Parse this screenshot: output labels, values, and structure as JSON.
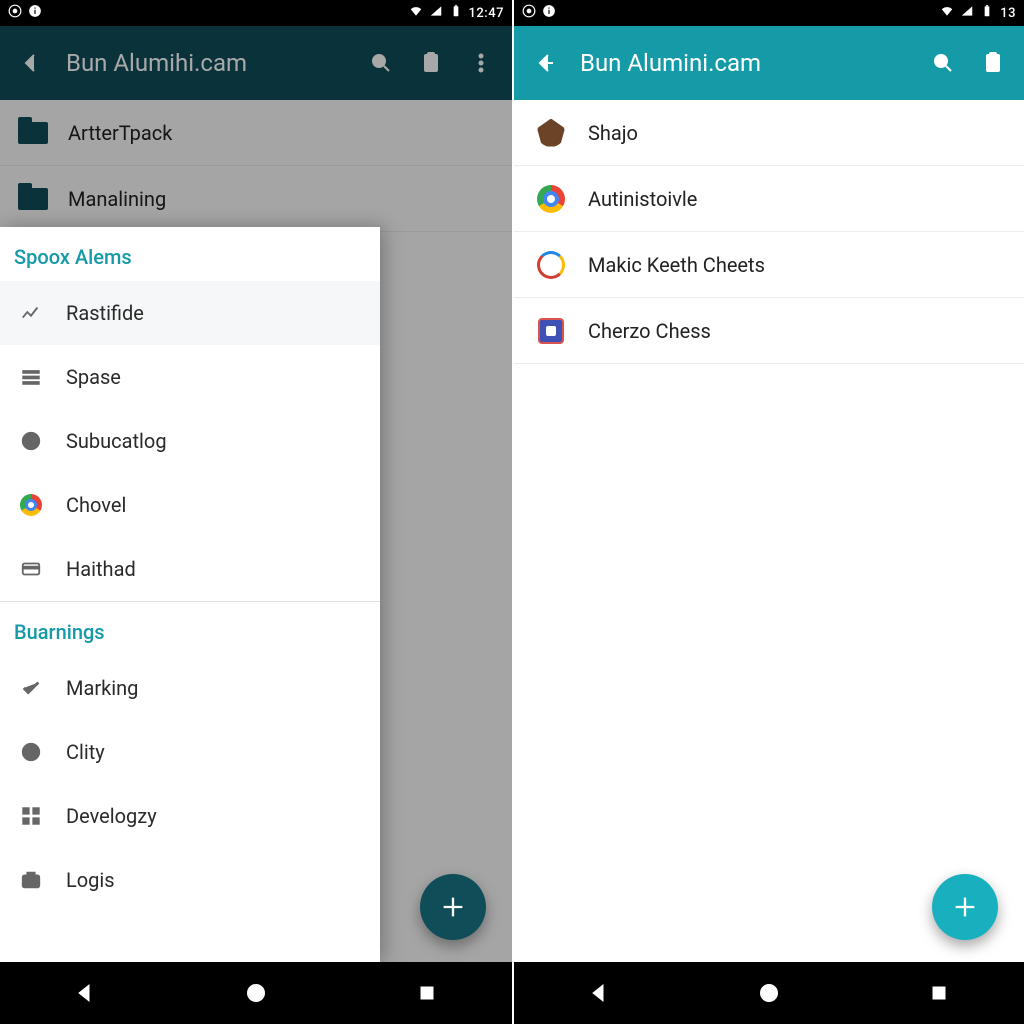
{
  "status": {
    "time_left": "12:47",
    "time_right": "13"
  },
  "left": {
    "appbar": {
      "title": "Bun Alumihi.cam"
    },
    "bg_items": [
      {
        "label": "ArtterTpack"
      },
      {
        "label": "Manalining"
      }
    ],
    "drawer": {
      "section1_title": "Spoox Alems",
      "section1_items": [
        {
          "label": "Rastifide",
          "icon": "chart-icon",
          "selected": true
        },
        {
          "label": "Spase",
          "icon": "list-icon"
        },
        {
          "label": "Subucatlog",
          "icon": "clock-icon"
        },
        {
          "label": "Chovel",
          "icon": "chrome-icon"
        },
        {
          "label": "Haithad",
          "icon": "card-icon"
        }
      ],
      "section2_title": "Buarnings",
      "section2_items": [
        {
          "label": "Marking",
          "icon": "check-icon"
        },
        {
          "label": "Clity",
          "icon": "play-circle-icon"
        },
        {
          "label": "Develogzy",
          "icon": "grid-icon"
        },
        {
          "label": "Logis",
          "icon": "camera-icon"
        }
      ]
    }
  },
  "right": {
    "appbar": {
      "title": "Bun Alumini.cam"
    },
    "items": [
      {
        "label": "Shajo",
        "icon": "shajo-icon"
      },
      {
        "label": "Autinistoivle",
        "icon": "chrome-icon"
      },
      {
        "label": "Makic Keeth Cheets",
        "icon": "sheets-icon"
      },
      {
        "label": "Cherzo Chess",
        "icon": "chess-icon"
      }
    ]
  },
  "colors": {
    "accent_left": "#0f4d59",
    "accent_right": "#159aa8"
  }
}
